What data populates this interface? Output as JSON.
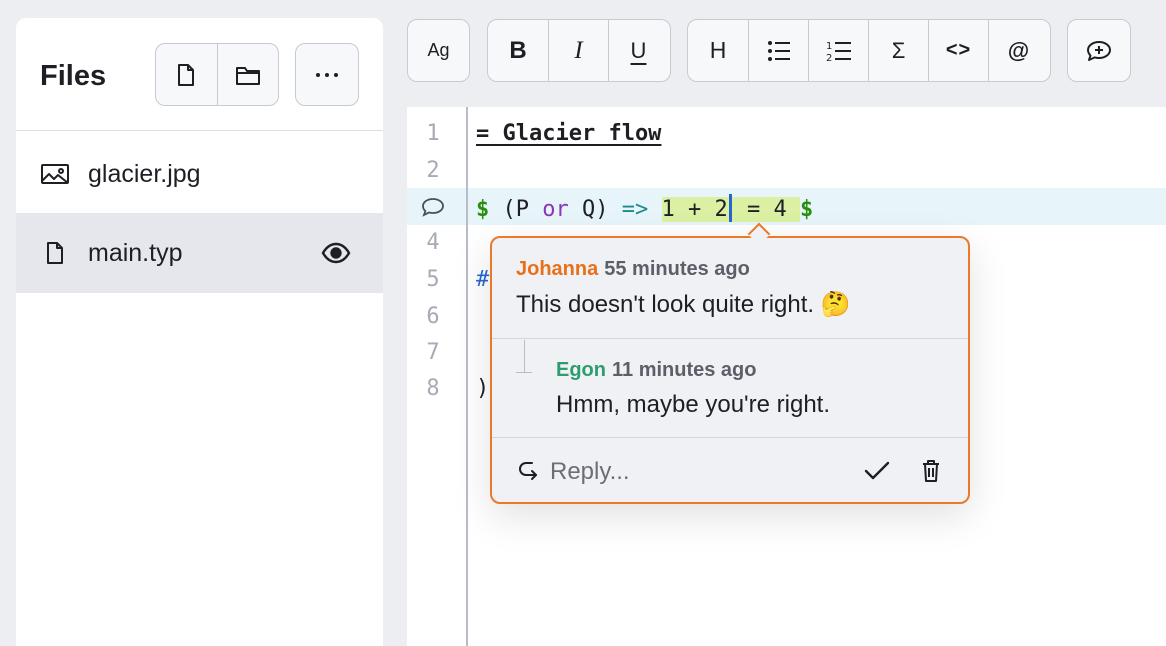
{
  "sidebar": {
    "title": "Files",
    "buttons": {
      "new_file": "new-file",
      "new_folder": "new-folder",
      "more": "more"
    },
    "files": [
      {
        "name": "glacier.jpg",
        "icon": "image-icon",
        "active": false
      },
      {
        "name": "main.typ",
        "icon": "file-icon",
        "active": true,
        "preview_icon": "eye-icon"
      }
    ]
  },
  "toolbar": {
    "font_label": "Ag",
    "bold": "B",
    "italic": "I",
    "underline": "U",
    "heading": "H",
    "sum": "Σ",
    "code": "<>",
    "mention": "@"
  },
  "editor": {
    "line_numbers": [
      "1",
      "2",
      "",
      "4",
      "5",
      "6",
      "7",
      "8"
    ],
    "line1": "= Glacier flow",
    "line3": {
      "open": "$",
      "paren_open": "(P ",
      "or": "or",
      "paren_close": " Q)",
      "arrow": "=>",
      "sel": "1 + 2",
      "rest": " = 4 ",
      "close": "$"
    },
    "line5_fragment": "#",
    "line8_fragment": ")"
  },
  "comment": {
    "thread": [
      {
        "author": "Johanna",
        "time": "55 minutes ago",
        "text": "This doesn't look quite right. 🤔",
        "color": "#e8701a"
      },
      {
        "author": "Egon",
        "time": "11 minutes ago",
        "text": "Hmm, maybe you're right.",
        "color": "#2e9d6e"
      }
    ],
    "reply_placeholder": "Reply..."
  },
  "colors": {
    "accent": "#ea7a2a",
    "selection": "#dbf0a3",
    "cursor": "#2566d4"
  }
}
